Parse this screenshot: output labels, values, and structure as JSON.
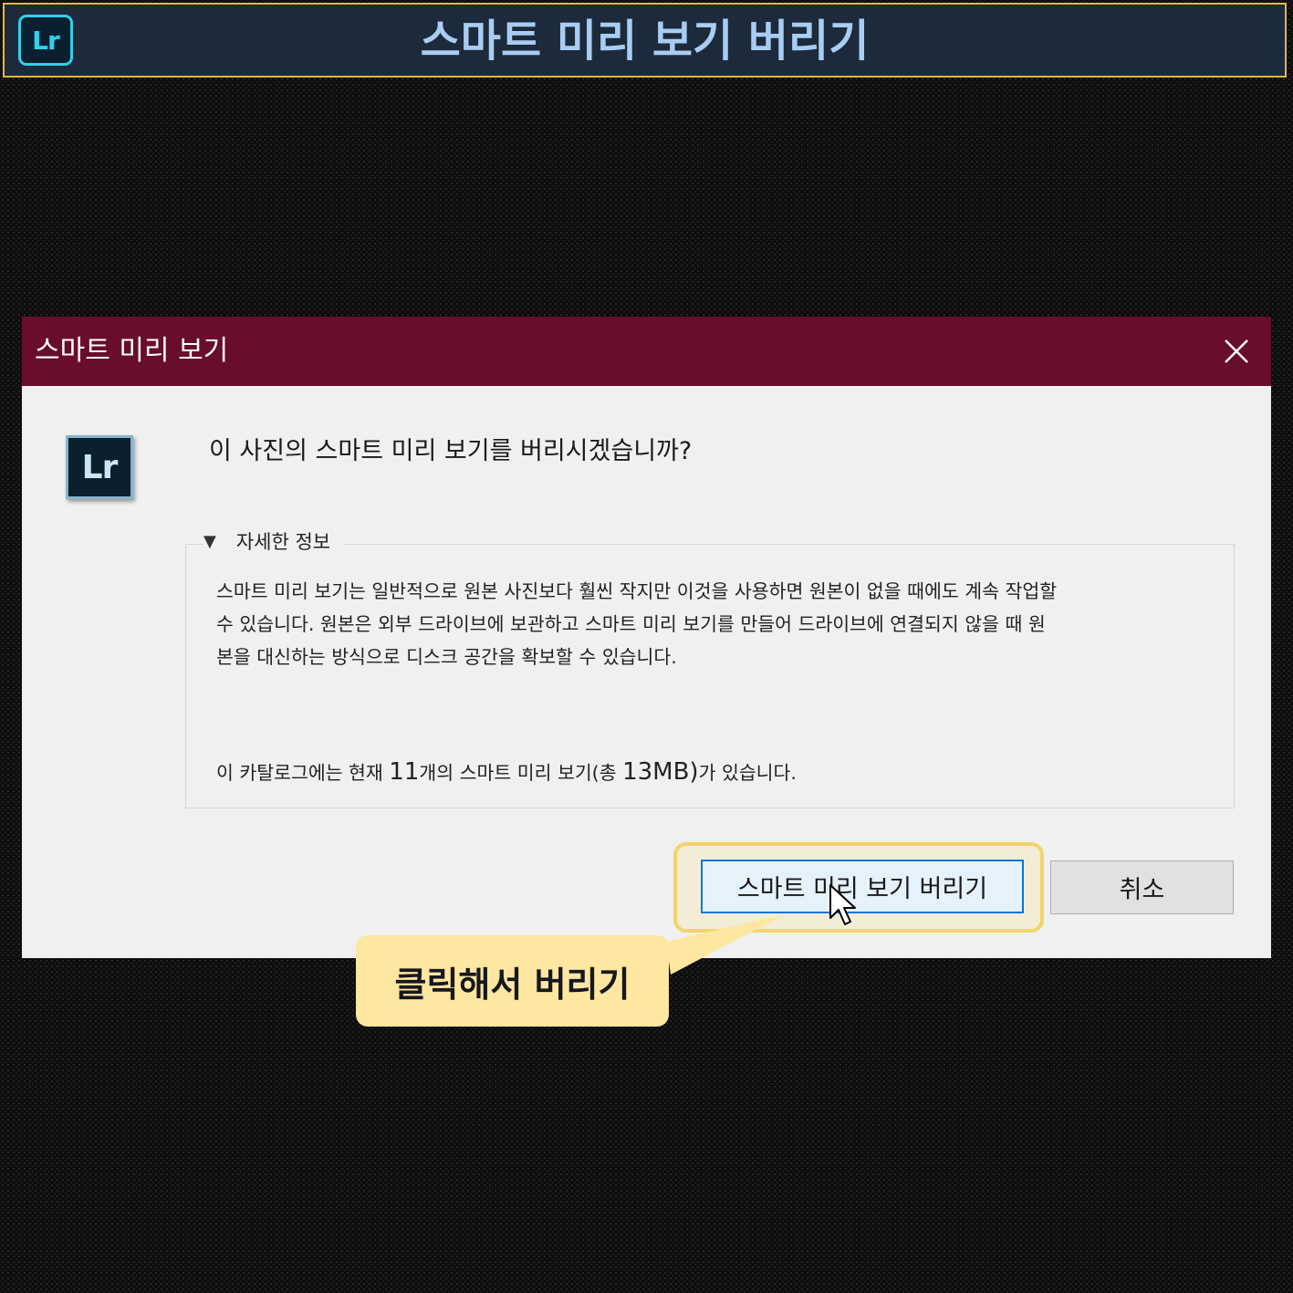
{
  "header": {
    "logo_text": "Lr",
    "title": "스마트 미리 보기 버리기"
  },
  "dialog": {
    "title": "스마트 미리 보기",
    "logo_text": "Lr",
    "question": "이 사진의 스마트 미리 보기를 버리시겠습니까?",
    "details": {
      "label": "자세한 정보",
      "description_lines": [
        "스마트 미리 보기는 일반적으로 원본 사진보다 훨씬 작지만 이것을 사용하면 원본이 없을 때에도 계속 작업할",
        "수 있습니다. 원본은 외부 드라이브에 보관하고 스마트 미리 보기를 만들어 드라이브에 연결되지 않을 때 원",
        "본을 대신하는 방식으로 디스크 공간을 확보할 수 있습니다."
      ],
      "count_prefix": "이 카탈로그에는 현재 ",
      "count_number": "11",
      "count_middle": "개의 스마트 미리 보기(",
      "count_total_label": "총 ",
      "count_size": "13MB)",
      "count_suffix": "가 있습니다."
    },
    "buttons": {
      "discard": "스마트 미리 보기 버리기",
      "cancel": "취소"
    }
  },
  "callout": {
    "text": "클릭해서 버리기"
  },
  "colors": {
    "header_bg": "#1d2a3b",
    "header_border": "#e6b53c",
    "title_text": "#a9cdf2",
    "dialog_titlebar": "#680d2b",
    "primary_button_border": "#0078d7",
    "callout_bg": "#fde7a1",
    "highlight_border": "#f3d46a"
  }
}
